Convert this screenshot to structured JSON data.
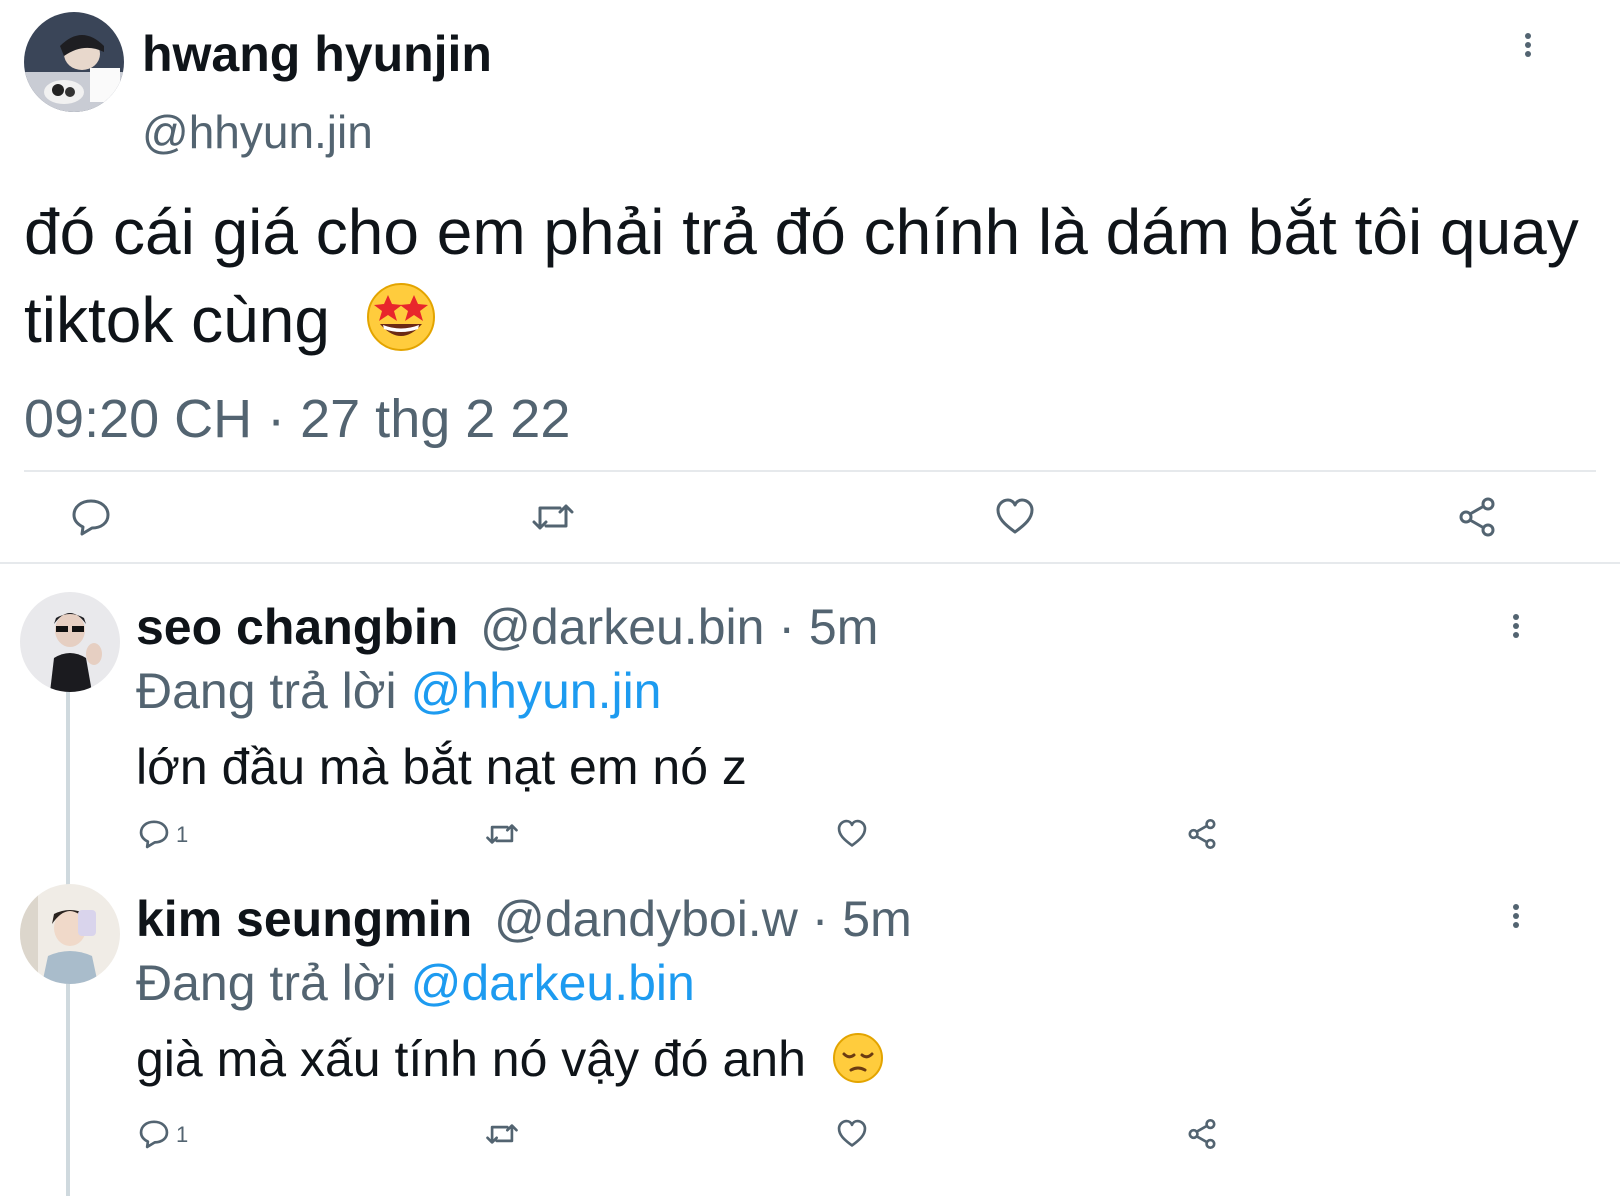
{
  "main_tweet": {
    "display_name": "hwang hyunjin",
    "handle": "@hhyun.jin",
    "text": "đó cái giá cho em phải trả đó chính là dám bắt tôi quay tiktok cùng",
    "emoji": "star-struck",
    "timestamp": "09:20 CH · 27 thg 2 22",
    "actions": [
      "reply-icon",
      "retweet-icon",
      "like-icon",
      "share-icon"
    ]
  },
  "replies": [
    {
      "display_name": "seo changbin",
      "handle": "@darkeu.bin",
      "separator": "·",
      "age": "5m",
      "replying_prefix": "Đang trả lời",
      "replying_to": "@hhyun.jin",
      "text": "lớn đầu mà bắt nạt em nó z",
      "reply_count": "1"
    },
    {
      "display_name": "kim seungmin",
      "handle": "@dandyboi.w",
      "separator": "·",
      "age": "5m",
      "replying_prefix": "Đang trả lời",
      "replying_to": "@darkeu.bin",
      "text": "già mà xấu tính nó vậy đó anh",
      "emoji": "pensive",
      "reply_count": "1"
    }
  ],
  "colors": {
    "text": "#0f1419",
    "muted": "#536471",
    "link": "#1d9bf0",
    "divider": "#e6e9ec"
  }
}
